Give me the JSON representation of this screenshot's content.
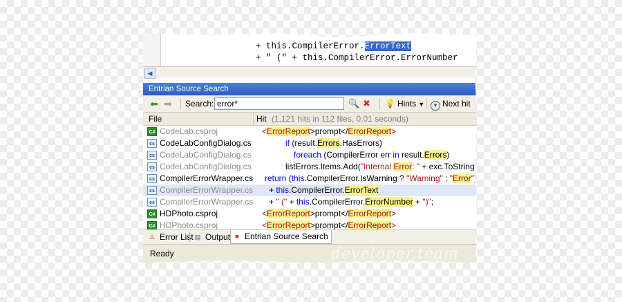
{
  "editor": {
    "line1_pre": "+ this.CompilerError.",
    "line1_sel": "ErrorText",
    "line2": "+ \" (\" + this.CompilerError.ErrorNumber"
  },
  "panel": {
    "title": "Entrian Source Search"
  },
  "toolbar": {
    "search_label": "Search:",
    "search_value": "error*",
    "hints_label": "Hints",
    "next_hit_label": "Next hit"
  },
  "table": {
    "col_file": "File",
    "col_hit": "Hit",
    "hit_count": "(1,121 hits in 112 files, 0.01 seconds)"
  },
  "rows": [
    {
      "file": "CodeLab.csproj",
      "dim": true,
      "icon": "csproj-icon"
    },
    {
      "file": "CodeLabConfigDialog.cs",
      "dim": false,
      "icon": "cs-file-icon"
    },
    {
      "file": "CodeLabConfigDialog.cs",
      "dim": true,
      "icon": "cs-file-icon"
    },
    {
      "file": "CodeLabConfigDialog.cs",
      "dim": true,
      "icon": "cs-file-icon"
    },
    {
      "file": "CompilerErrorWrapper.cs",
      "dim": false,
      "icon": "cs-file-icon"
    },
    {
      "file": "CompilerErrorWrapper.cs",
      "dim": true,
      "icon": "cs-file-icon"
    },
    {
      "file": "CompilerErrorWrapper.cs",
      "dim": true,
      "icon": "cs-file-icon"
    },
    {
      "file": "HDPhoto.csproj",
      "dim": false,
      "icon": "csproj-icon"
    },
    {
      "file": "HDPhoto.csproj",
      "dim": true,
      "icon": "csproj-icon"
    }
  ],
  "hits": {
    "r0": [
      "<",
      "ErrorReport",
      ">prompt</",
      "ErrorReport",
      ">"
    ],
    "r1": [
      "if",
      " (result.",
      "Errors",
      ".HasErrors)"
    ],
    "r2": [
      "foreach",
      " (CompilerError err ",
      "in",
      " result.",
      "Errors",
      ")"
    ],
    "r3": [
      "listErrors.Items.Add(",
      "\"Internal ",
      "Error",
      ": \"",
      " + exc.ToString());"
    ],
    "r4": [
      "return",
      " (",
      "this",
      ".CompilerError.IsWarning  ? ",
      "\"Warning\"",
      " : ",
      "\"",
      "Error",
      "\"",
      ")"
    ],
    "r5": [
      "+ ",
      "this",
      ".CompilerError.",
      "ErrorText"
    ],
    "r6": [
      "+ ",
      "\" (\"",
      " + ",
      "this",
      ".CompilerError.",
      "ErrorNumber",
      " + ",
      "\")\"",
      ";"
    ],
    "r7": [
      "<",
      "ErrorReport",
      ">prompt</",
      "ErrorReport",
      ">"
    ],
    "r8": [
      "<",
      "ErrorReport",
      ">prompt</",
      "ErrorReport",
      ">"
    ]
  },
  "tabs": [
    {
      "label": "Error List",
      "icon": "error-list-icon"
    },
    {
      "label": "Output",
      "icon": "output-icon"
    },
    {
      "label": "Entrian Source Search",
      "icon": "entrian-icon",
      "active": true
    }
  ],
  "status": {
    "text": "Ready",
    "watermark": "developer.team"
  }
}
